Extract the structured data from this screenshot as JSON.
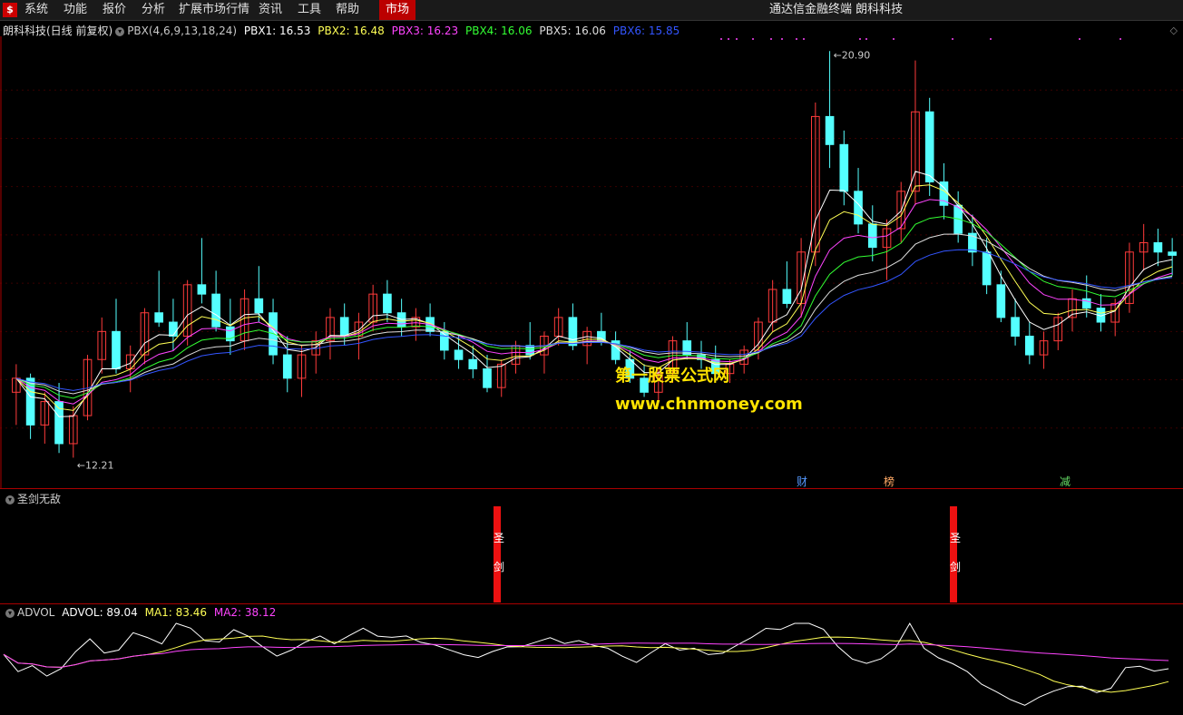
{
  "menu": {
    "items": [
      "系统",
      "功能",
      "报价",
      "分析",
      "扩展市场行情",
      "资讯",
      "工具",
      "帮助"
    ],
    "active": "市场",
    "app_title": "通达信金融终端  朗科科技"
  },
  "main_panel": {
    "stock": "朗科科技(日线 前复权)",
    "indicator": "PBX(4,6,9,13,18,24)",
    "pbx1": "PBX1: 16.53",
    "pbx2": "PBX2: 16.48",
    "pbx3": "PBX3: 16.23",
    "pbx4": "PBX4: 16.06",
    "pbx5": "PBX5: 16.06",
    "pbx6": "PBX6: 15.85",
    "high_label": "20.90",
    "low_label": "12.21",
    "events": [
      "财",
      "榜",
      "减"
    ],
    "watermark1": "第一股票公式网",
    "watermark2": "www.chnmoney.com",
    "colors": {
      "up": "#ff3b3b",
      "down": "#54ffff",
      "pbx1": "#ffffff",
      "pbx2": "#ffff55",
      "pbx3": "#ff44ff",
      "pbx4": "#33ff33",
      "pbx5": "#dddddd",
      "pbx6": "#3355ff"
    }
  },
  "sword_panel": {
    "title": "圣剑无敌",
    "bar_label_1": "圣",
    "bar_label_2": "剑"
  },
  "advol_panel": {
    "name": "ADVOL",
    "advol": "ADVOL: 89.04",
    "ma1": "MA1: 83.46",
    "ma2": "MA2: 38.12"
  },
  "chart_data": {
    "type": "candlestick",
    "title": "朗科科技(日线 前复权)",
    "price_marks": {
      "high": 20.9,
      "low": 12.21
    },
    "latest": {
      "PBX1": 16.53,
      "PBX2": 16.48,
      "PBX3": 16.23,
      "PBX4": 16.06,
      "PBX5": 16.06,
      "PBX6": 15.85
    },
    "candles_ohlc_approx": [
      [
        13.6,
        14.2,
        12.9,
        13.9
      ],
      [
        13.9,
        14.0,
        12.6,
        12.9
      ],
      [
        12.9,
        13.6,
        12.5,
        13.4
      ],
      [
        13.4,
        13.8,
        12.3,
        12.5
      ],
      [
        12.5,
        13.3,
        12.2,
        13.1
      ],
      [
        13.1,
        14.4,
        13.0,
        14.3
      ],
      [
        14.3,
        15.2,
        14.0,
        14.9
      ],
      [
        14.9,
        15.6,
        14.0,
        14.1
      ],
      [
        14.1,
        14.6,
        13.6,
        14.4
      ],
      [
        14.4,
        15.4,
        14.2,
        15.3
      ],
      [
        15.3,
        16.2,
        15.0,
        15.1
      ],
      [
        15.1,
        15.6,
        14.5,
        14.8
      ],
      [
        14.8,
        16.0,
        14.6,
        15.9
      ],
      [
        15.9,
        16.9,
        15.5,
        15.7
      ],
      [
        15.7,
        16.2,
        14.9,
        15.0
      ],
      [
        15.0,
        15.6,
        14.4,
        14.7
      ],
      [
        14.7,
        15.8,
        14.5,
        15.6
      ],
      [
        15.6,
        16.3,
        15.1,
        15.3
      ],
      [
        15.3,
        15.6,
        14.2,
        14.4
      ],
      [
        14.4,
        14.8,
        13.6,
        13.9
      ],
      [
        13.9,
        14.6,
        13.5,
        14.4
      ],
      [
        14.4,
        14.9,
        14.0,
        14.7
      ],
      [
        14.7,
        15.4,
        14.3,
        15.2
      ],
      [
        15.2,
        15.5,
        14.6,
        14.8
      ],
      [
        14.8,
        15.3,
        14.3,
        15.1
      ],
      [
        15.1,
        15.9,
        14.9,
        15.7
      ],
      [
        15.7,
        16.0,
        15.1,
        15.3
      ],
      [
        15.3,
        15.6,
        14.8,
        15.0
      ],
      [
        15.0,
        15.4,
        14.7,
        15.2
      ],
      [
        15.2,
        15.5,
        14.8,
        14.9
      ],
      [
        14.9,
        15.1,
        14.3,
        14.5
      ],
      [
        14.5,
        14.8,
        14.1,
        14.3
      ],
      [
        14.3,
        14.6,
        13.9,
        14.1
      ],
      [
        14.1,
        14.4,
        13.6,
        13.7
      ],
      [
        13.7,
        14.3,
        13.5,
        14.2
      ],
      [
        14.2,
        14.7,
        14.0,
        14.6
      ],
      [
        14.6,
        15.1,
        14.3,
        14.4
      ],
      [
        14.4,
        14.9,
        14.0,
        14.8
      ],
      [
        14.8,
        15.4,
        14.6,
        15.2
      ],
      [
        15.2,
        15.5,
        14.5,
        14.6
      ],
      [
        14.6,
        15.0,
        14.2,
        14.9
      ],
      [
        14.9,
        15.3,
        14.6,
        14.7
      ],
      [
        14.7,
        14.9,
        14.2,
        14.3
      ],
      [
        14.3,
        14.5,
        13.8,
        13.9
      ],
      [
        13.9,
        14.2,
        13.5,
        13.6
      ],
      [
        13.6,
        14.1,
        13.4,
        14.0
      ],
      [
        14.0,
        14.8,
        13.8,
        14.7
      ],
      [
        14.7,
        15.1,
        14.3,
        14.4
      ],
      [
        14.4,
        14.7,
        14.1,
        14.3
      ],
      [
        14.3,
        14.6,
        13.9,
        14.0
      ],
      [
        14.0,
        14.3,
        13.8,
        14.2
      ],
      [
        14.2,
        14.6,
        14.0,
        14.5
      ],
      [
        14.5,
        15.2,
        14.3,
        15.1
      ],
      [
        15.1,
        16.0,
        14.9,
        15.8
      ],
      [
        15.8,
        16.4,
        15.4,
        15.5
      ],
      [
        15.5,
        16.9,
        15.2,
        16.6
      ],
      [
        16.6,
        19.8,
        16.3,
        19.5
      ],
      [
        19.5,
        20.9,
        18.4,
        18.9
      ],
      [
        18.9,
        19.2,
        17.6,
        17.9
      ],
      [
        17.9,
        18.4,
        17.0,
        17.2
      ],
      [
        17.2,
        17.6,
        16.4,
        16.7
      ],
      [
        16.7,
        17.3,
        16.0,
        17.1
      ],
      [
        17.1,
        18.1,
        16.8,
        17.9
      ],
      [
        17.9,
        20.7,
        17.6,
        19.6
      ],
      [
        19.6,
        19.9,
        17.8,
        18.1
      ],
      [
        18.1,
        18.5,
        17.3,
        17.6
      ],
      [
        17.6,
        17.9,
        16.8,
        17.0
      ],
      [
        17.0,
        17.4,
        16.3,
        16.6
      ],
      [
        16.6,
        16.9,
        15.7,
        15.9
      ],
      [
        15.9,
        16.2,
        15.1,
        15.2
      ],
      [
        15.2,
        15.6,
        14.6,
        14.8
      ],
      [
        14.8,
        15.1,
        14.2,
        14.4
      ],
      [
        14.4,
        14.9,
        14.1,
        14.7
      ],
      [
        14.7,
        15.3,
        14.5,
        15.2
      ],
      [
        15.2,
        15.8,
        14.9,
        15.6
      ],
      [
        15.6,
        16.1,
        15.2,
        15.4
      ],
      [
        15.4,
        15.7,
        14.9,
        15.1
      ],
      [
        15.1,
        15.6,
        14.8,
        15.5
      ],
      [
        15.5,
        16.8,
        15.3,
        16.6
      ],
      [
        16.6,
        17.2,
        16.2,
        16.8
      ],
      [
        16.8,
        17.1,
        16.3,
        16.6
      ],
      [
        16.6,
        16.9,
        16.1,
        16.53
      ]
    ]
  }
}
